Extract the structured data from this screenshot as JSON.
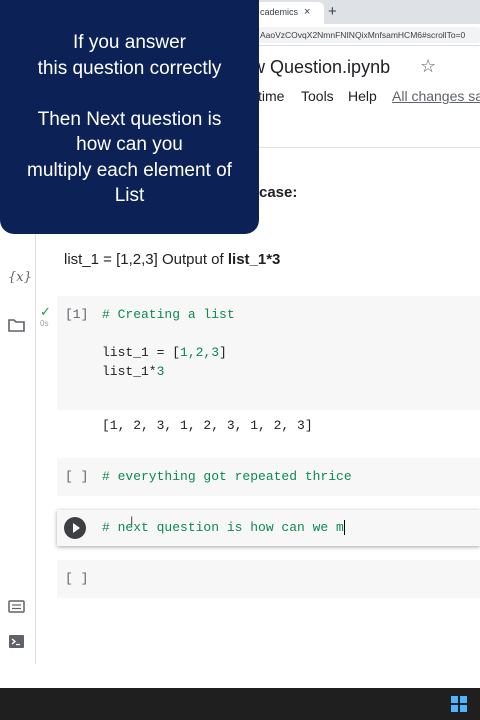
{
  "browser": {
    "tab_title": "cademics",
    "tab_close": "×",
    "new_tab": "+",
    "url": "AaoVzCOvqX2NmnFNINQixMnfsamHCM6#scrollTo=0"
  },
  "notebook": {
    "title": "ew Question.ipynb",
    "star": "☆",
    "menu": [
      "time",
      "Tools",
      "Help"
    ],
    "save_status": "All changes sa"
  },
  "sidebar": {
    "variables_icon": "{x}",
    "files_icon": "folder-icon",
    "snippets_icon": "keyboard-icon",
    "terminal_icon": "terminal-icon"
  },
  "text_cell": {
    "heading_tail": "case:",
    "line_prefix": "list_1 = [1,2,3] Output of ",
    "line_bold": "list_1*3"
  },
  "cells": [
    {
      "exec": "[1]",
      "status": "✓",
      "time": "0s",
      "comment": "# Creating a list",
      "line2_var": "list_1 = [",
      "line2_nums": "1,2,3",
      "line2_end": "]",
      "line3_var": "list_1*",
      "line3_num": "3",
      "output": "[1, 2, 3, 1, 2, 3, 1, 2, 3]"
    },
    {
      "exec": "[ ]",
      "comment": "# everything got repeated thrice"
    },
    {
      "comment": "# next question is how can we m"
    },
    {
      "exec": "[ ]"
    }
  ],
  "overlay": {
    "text": "If you answer\nthis question correctly\n\nThen Next question is\nhow can you\nmultiply each element of\nList"
  },
  "colors": {
    "overlay_bg": "#0c2257",
    "comment_green": "#0d8a52",
    "taskbar": "#1f1f1f"
  }
}
